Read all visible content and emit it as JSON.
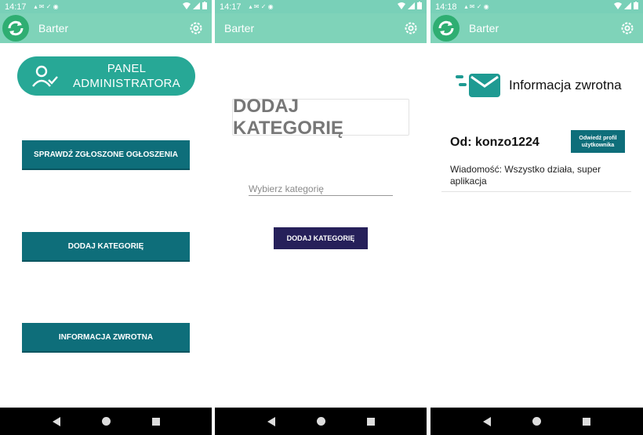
{
  "screens": [
    {
      "status": {
        "time": "14:17"
      },
      "appbar": {
        "title": "Barter"
      },
      "panel": {
        "line1": "PANEL",
        "line2": "ADMINISTRATORA"
      },
      "buttons": [
        "SPRAWDŹ ZGŁOSZONE OGŁOSZENIA",
        "DODAJ KATEGORIĘ",
        "INFORMACJA ZWROTNA"
      ]
    },
    {
      "status": {
        "time": "14:17"
      },
      "appbar": {
        "title": "Barter"
      },
      "heading": "DODAJ KATEGORIĘ",
      "input": {
        "value": "",
        "placeholder": "Wybierz kategorię"
      },
      "submit": "DODAJ KATEGORIĘ"
    },
    {
      "status": {
        "time": "14:18"
      },
      "appbar": {
        "title": "Barter"
      },
      "header": "Informacja zwrotna",
      "feedback": {
        "from": "Od: konzo1224",
        "visit_button": "Odwiedź profil użytkownika",
        "message": "Wiadomość: Wszystko działa, super aplikacja"
      }
    }
  ],
  "colors": {
    "appbar": "#7fd3b9",
    "primary_button": "#0e6e7a",
    "submit_button": "#26205a",
    "panel": "#27a896"
  },
  "icons": [
    "refresh-logo-icon",
    "gear-icon",
    "user-check-icon",
    "mail-fast-icon",
    "back-icon",
    "home-icon",
    "recents-icon"
  ]
}
